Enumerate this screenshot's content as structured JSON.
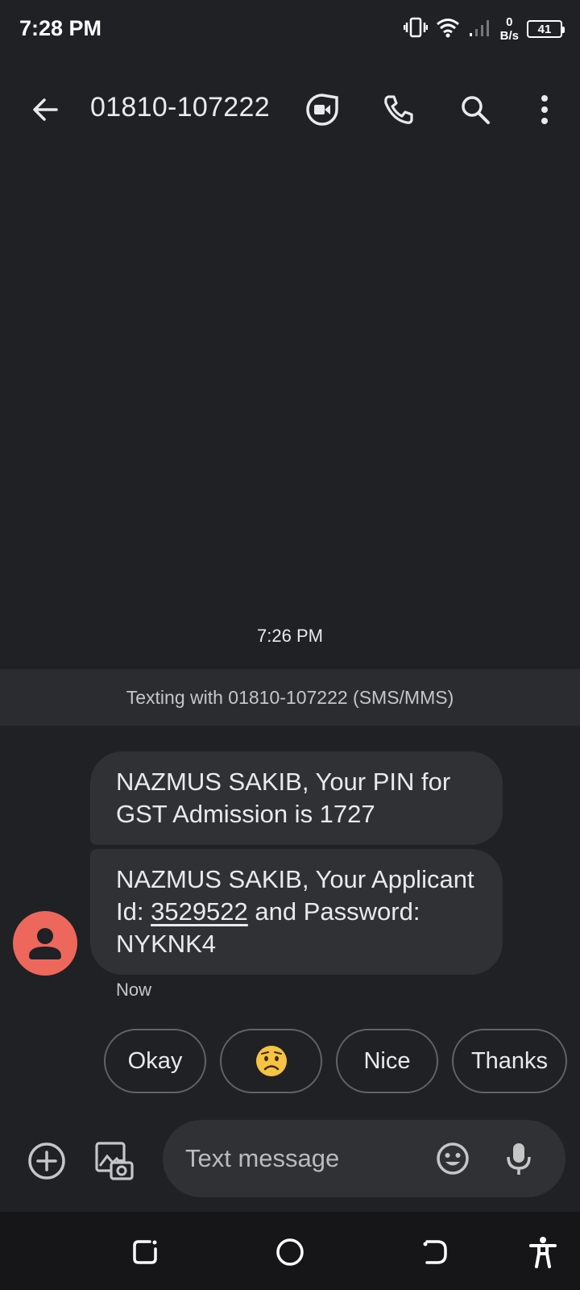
{
  "status_bar": {
    "time": "7:28 PM",
    "net_speed_value": "0",
    "net_speed_unit": "B/s",
    "battery": "41"
  },
  "app_bar": {
    "title": "01810-107222",
    "icons": [
      "back-arrow-icon",
      "video-call-icon",
      "phone-icon",
      "search-icon",
      "more-vert-icon"
    ]
  },
  "conversation": {
    "timestamp": "7:26 PM",
    "banner": "Texting with 01810-107222 (SMS/MMS)",
    "messages": [
      {
        "text": "NAZMUS SAKIB, Your PIN for GST Admission is 1727"
      },
      {
        "before": "NAZMUS SAKIB, Your Applicant Id: ",
        "link": "3529522",
        "after": " and Password: NYKNK4"
      }
    ],
    "sent_time": "Now"
  },
  "smart_replies": [
    "Okay",
    "😟",
    "Nice",
    "Thanks"
  ],
  "compose": {
    "placeholder": "Text message",
    "icons": [
      "add-circle-icon",
      "gallery-icon",
      "emoji-icon",
      "mic-icon"
    ]
  },
  "nav_bar": {
    "icons": [
      "recents-icon",
      "home-icon",
      "back-icon",
      "accessibility-icon"
    ]
  }
}
